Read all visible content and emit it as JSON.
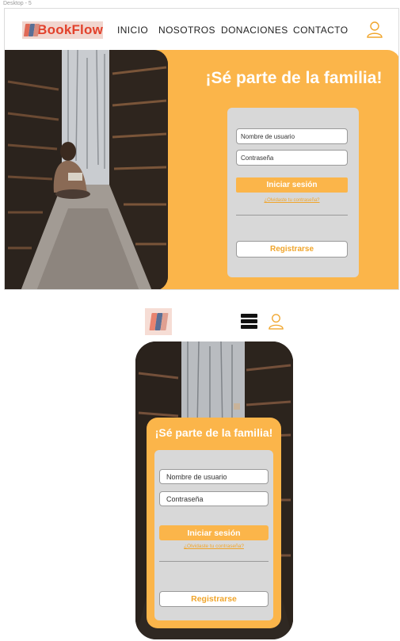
{
  "frame_label": "Desktop - 5",
  "brand": {
    "name": "BookFlow"
  },
  "nav": {
    "items": [
      {
        "label": "INICIO"
      },
      {
        "label": "NOSOTROS"
      },
      {
        "label": "DONACIONES"
      },
      {
        "label": "CONTACTO"
      }
    ],
    "user_icon": "user-icon"
  },
  "hero": {
    "title": "¡Sé parte de la familia!",
    "image": "library-reading-photo"
  },
  "login": {
    "username_placeholder": "Nombre de usuario",
    "password_placeholder": "Contraseña",
    "submit_label": "Iniciar sesión",
    "forgot_label": "¿Olvidaste tu contraseña?",
    "register_label": "Registrarse"
  },
  "mobile": {
    "menu_icon": "hamburger-menu-icon",
    "user_icon": "user-icon"
  },
  "colors": {
    "accent": "#fbb54a",
    "card": "#d8d8d8",
    "brand_red": "#e2412b",
    "link": "#f0a52b"
  }
}
